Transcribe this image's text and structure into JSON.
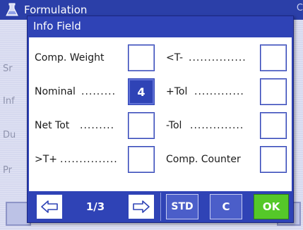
{
  "background": {
    "title": "Formulation",
    "title_right": "C",
    "rows": [
      "Sr",
      "Inf",
      "Du",
      "Pr"
    ]
  },
  "dialog": {
    "title": "Info Field",
    "fields_left": [
      {
        "label": "Comp. Weight",
        "dots": "",
        "value": "",
        "active": false
      },
      {
        "label": "Nominal",
        "dots": ".........",
        "value": "4",
        "active": true
      },
      {
        "label": "Net Tot",
        "dots": ".........",
        "value": "",
        "active": false
      },
      {
        "label": ">T+",
        "dots": "...............",
        "value": "",
        "active": false
      }
    ],
    "fields_right": [
      {
        "label": "<T-",
        "dots": "...............",
        "value": "",
        "active": false
      },
      {
        "label": "+Tol",
        "dots": ".............",
        "value": "",
        "active": false
      },
      {
        "label": "-Tol",
        "dots": "..............",
        "value": "",
        "active": false
      },
      {
        "label": "Comp. Counter",
        "dots": "",
        "value": "",
        "active": false
      }
    ],
    "toolbar": {
      "prev_icon": "arrow-left-icon",
      "page": "1/3",
      "next_icon": "arrow-right-icon",
      "std_label": "STD",
      "c_label": "C",
      "ok_label": "OK"
    }
  },
  "colors": {
    "dialog_blue": "#2f43b6",
    "ok_green": "#55c829",
    "bg_lavender": "#d6d9ef"
  }
}
